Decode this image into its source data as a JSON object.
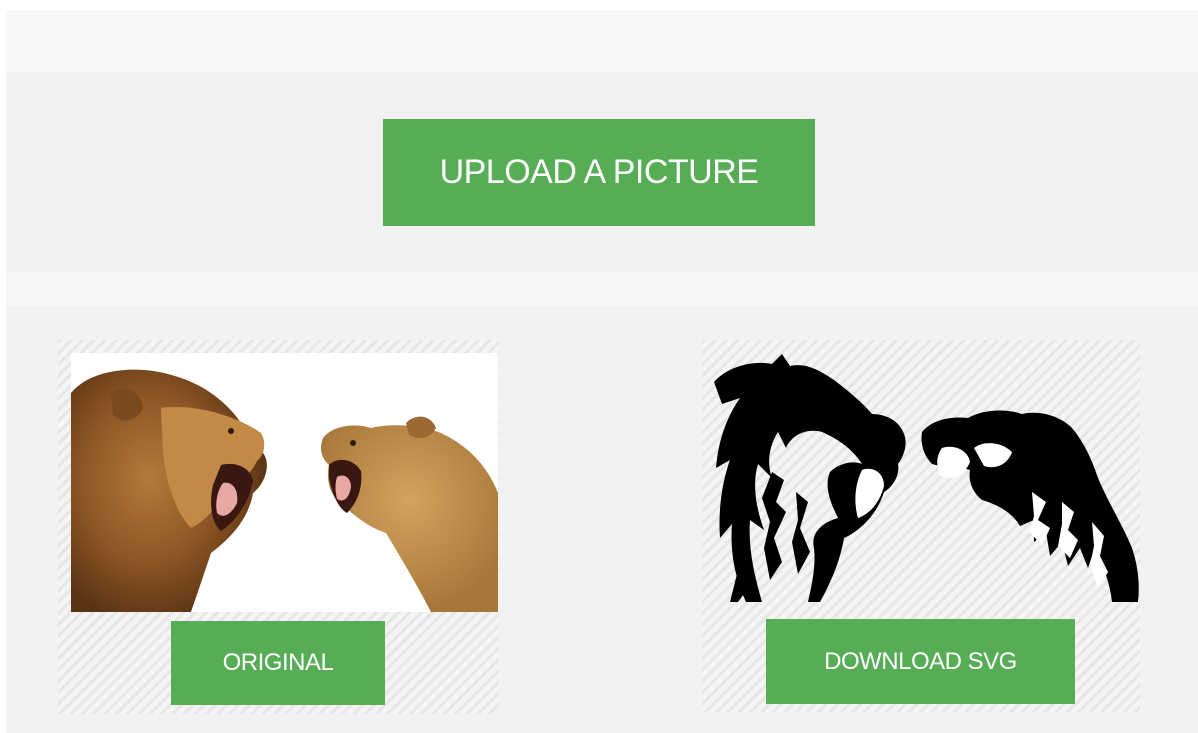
{
  "upload": {
    "button_label": "UPLOAD A PICTURE"
  },
  "original_panel": {
    "button_label": "ORIGINAL",
    "image_icon": "lion-photo"
  },
  "result_panel": {
    "button_label": "DOWNLOAD SVG",
    "image_icon": "lion-vector-trace"
  },
  "colors": {
    "button_green": "#56ad56",
    "button_text": "#ffffff",
    "band_light": "#f7f7f7",
    "band_mid": "#f2f2f2",
    "stripe": "#e6e6e6"
  }
}
